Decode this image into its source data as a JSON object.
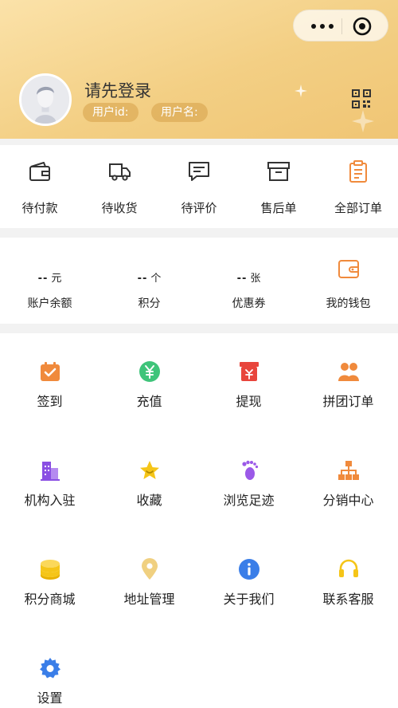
{
  "header": {
    "login_prompt": "请先登录",
    "user_id_label": "用户id:",
    "user_name_label": "用户名:"
  },
  "orders": [
    {
      "label": "待付款",
      "icon": "wallet-icon"
    },
    {
      "label": "待收货",
      "icon": "delivery-truck-icon"
    },
    {
      "label": "待评价",
      "icon": "comment-icon"
    },
    {
      "label": "售后单",
      "icon": "archive-box-icon"
    },
    {
      "label": "全部订单",
      "icon": "clipboard-icon"
    }
  ],
  "wallet": {
    "balance": {
      "value": "--",
      "unit": "元",
      "label": "账户余额"
    },
    "points": {
      "value": "--",
      "unit": "个",
      "label": "积分"
    },
    "coupons": {
      "value": "--",
      "unit": "张",
      "label": "优惠券"
    },
    "my_wallet": {
      "label": "我的钱包",
      "icon": "wallet-icon"
    }
  },
  "services": [
    {
      "label": "签到",
      "icon": "calendar-check-icon",
      "color": "#f08a3c"
    },
    {
      "label": "充值",
      "icon": "yen-circle-icon",
      "color": "#3fc47a"
    },
    {
      "label": "提现",
      "icon": "withdraw-box-icon",
      "color": "#e8453c"
    },
    {
      "label": "拼团订单",
      "icon": "group-users-icon",
      "color": "#f08a3c"
    },
    {
      "label": "机构入驻",
      "icon": "building-icon",
      "color": "#8a4fe3"
    },
    {
      "label": "收藏",
      "icon": "star-icon",
      "color": "#f5c518"
    },
    {
      "label": "浏览足迹",
      "icon": "footprint-icon",
      "color": "#9b59e8"
    },
    {
      "label": "分销中心",
      "icon": "org-chart-icon",
      "color": "#f08a3c"
    },
    {
      "label": "积分商城",
      "icon": "coin-stack-icon",
      "color": "#f5c518"
    },
    {
      "label": "地址管理",
      "icon": "location-pin-icon",
      "color": "#f0d080"
    },
    {
      "label": "关于我们",
      "icon": "info-icon",
      "color": "#3a7ee8"
    },
    {
      "label": "联系客服",
      "icon": "headset-icon",
      "color": "#f5c518"
    },
    {
      "label": "设置",
      "icon": "gear-icon",
      "color": "#3a7ee8"
    }
  ]
}
